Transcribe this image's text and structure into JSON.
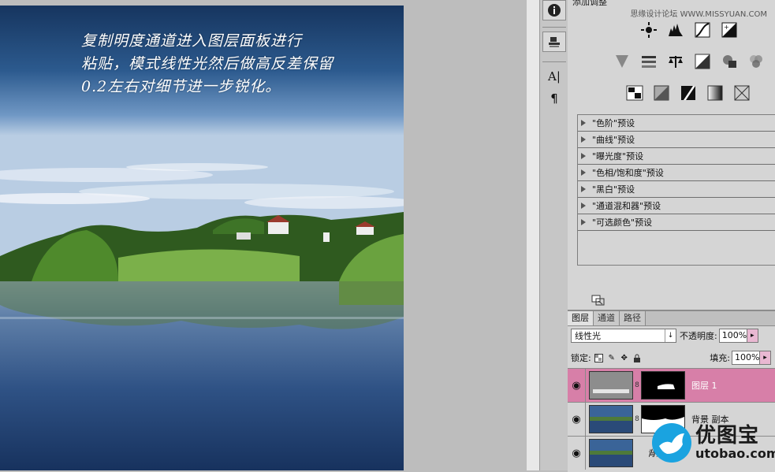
{
  "caption_lines": [
    "复制明度通道进入图层面板进行",
    "粘贴，模式线性光然后做高反差保留",
    "0.2左右对细节进一步锐化。"
  ],
  "adjustments": {
    "title": "添加调整",
    "watermark": "思缘设计论坛 WWW.MISSYUAN.COM",
    "row1_icons": [
      "brightness-icon",
      "levels-icon",
      "curves-icon",
      "exposure-icon"
    ],
    "row2_icons": [
      "vibrance-icon",
      "hue-saturation-icon",
      "color-balance-icon",
      "black-white-icon",
      "photo-filter-icon",
      "channel-mixer-icon"
    ],
    "row3_icons": [
      "invert-icon",
      "posterize-icon",
      "threshold-icon",
      "gradient-map-icon",
      "selective-color-icon"
    ],
    "presets": [
      "\"色阶\"预设",
      "\"曲线\"预设",
      "\"曝光度\"预设",
      "\"色相/饱和度\"预设",
      "\"黑白\"预设",
      "\"通道混和器\"预设",
      "\"可选颜色\"预设"
    ]
  },
  "layers_panel": {
    "tabs": [
      "图层",
      "通道",
      "路径"
    ],
    "blend_mode": "线性光",
    "opacity_label": "不透明度:",
    "opacity_value": "100%",
    "lock_label": "锁定:",
    "fill_label": "填充:",
    "fill_value": "100%",
    "layers": [
      {
        "name": "图层 1",
        "selected": true
      },
      {
        "name": "背景 副本",
        "selected": false
      },
      {
        "name": "背景",
        "selected": false
      }
    ]
  },
  "logo": {
    "cn": "优图宝",
    "en": "utobao.com"
  },
  "colors": {
    "selected_layer": "#d77fa8",
    "sky_top": "#1d3f6e",
    "water": "#2a4a78"
  }
}
